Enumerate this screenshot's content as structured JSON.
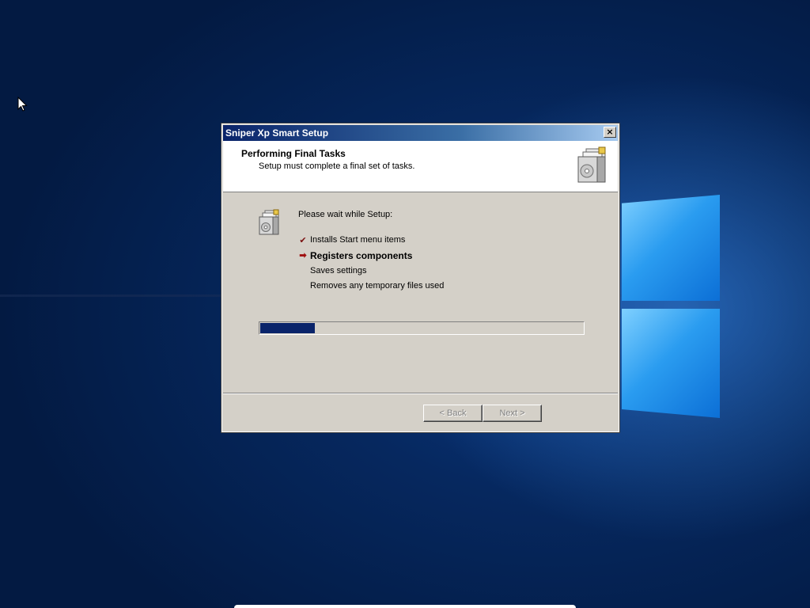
{
  "dialog": {
    "title": "Sniper Xp Smart Setup",
    "close_label": "×",
    "header": {
      "title": "Performing Final Tasks",
      "subtitle": "Setup must complete a final set of tasks."
    },
    "intro": "Please wait while Setup:",
    "tasks": [
      {
        "label": "Installs Start menu items",
        "status": "done",
        "mark": "✔"
      },
      {
        "label": "Registers components",
        "status": "current",
        "mark": "➡"
      },
      {
        "label": "Saves settings",
        "status": "pending",
        "mark": ""
      },
      {
        "label": "Removes any temporary files used",
        "status": "pending",
        "mark": ""
      }
    ],
    "progress_fraction": 0.17,
    "buttons": {
      "back": "< Back",
      "next": "Next >"
    }
  },
  "colors": {
    "titlebar_start": "#0a246a",
    "titlebar_end": "#a6caf0",
    "dialog_face": "#d4d0c8",
    "progress_fill": "#0a246a",
    "desktop_bg": "#06285f"
  },
  "icons": {
    "header": "installer-box-icon",
    "body": "installer-box-icon",
    "cursor": "mouse-pointer-icon"
  }
}
